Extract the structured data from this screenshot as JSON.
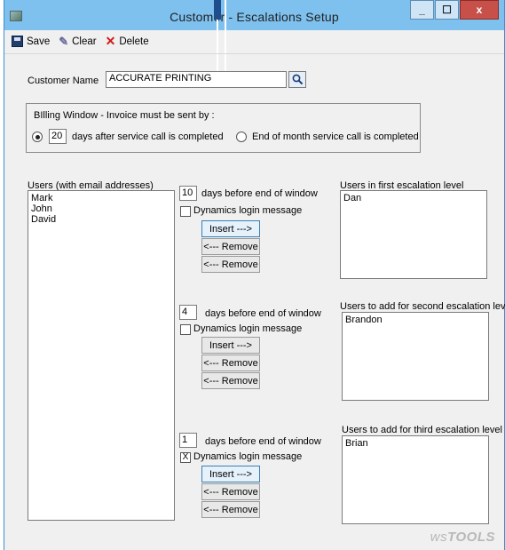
{
  "window": {
    "title": "Customer - Escalations Setup",
    "controls": {
      "minimize": "_",
      "maximize": "☐",
      "close": "x"
    }
  },
  "toolbar": {
    "save_label": "Save",
    "clear_label": "Clear",
    "delete_label": "Delete"
  },
  "customer": {
    "label": "Customer Name",
    "value": "ACCURATE PRINTING"
  },
  "billing": {
    "legend": "BIlling Window - Invoice must be sent by :",
    "days_value": "20",
    "days_text": "days after service call is completed",
    "end_of_month_text": "End of month service call is completed",
    "selected": "days"
  },
  "users": {
    "header": "Users (with email addresses)",
    "items": [
      "Mark",
      "John",
      "David"
    ]
  },
  "levels": [
    {
      "days_value": "10",
      "days_text": "days before end of window",
      "login_text": "Dynamics login message",
      "login_checked": false,
      "login_mark": "",
      "insert_label": "Insert --->",
      "remove1_label": "<--- Remove",
      "remove2_label": "<--- Remove",
      "list_header": "Users in first escalation level",
      "list_items": [
        "Dan"
      ]
    },
    {
      "days_value": "4",
      "days_text": "days before end of window",
      "login_text": "Dynamics login message",
      "login_checked": false,
      "login_mark": "",
      "insert_label": "Insert --->",
      "remove1_label": "<--- Remove",
      "remove2_label": "<--- Remove",
      "list_header": "Users to add for second escalation level",
      "list_items": [
        "Brandon"
      ]
    },
    {
      "days_value": "1",
      "days_text": "days before end of window",
      "login_text": "Dynamics login message",
      "login_checked": true,
      "login_mark": "X",
      "insert_label": "Insert --->",
      "remove1_label": "<--- Remove",
      "remove2_label": "<--- Remove",
      "list_header": "Users to add for third escalation level",
      "list_items": [
        "Brian"
      ]
    }
  ],
  "footer": {
    "brand_prefix": "ws",
    "brand_main": "TOOLS"
  },
  "colors": {
    "titlebar": "#7ec0ee",
    "close_button": "#c7504a",
    "delete_icon": "#d21818"
  }
}
